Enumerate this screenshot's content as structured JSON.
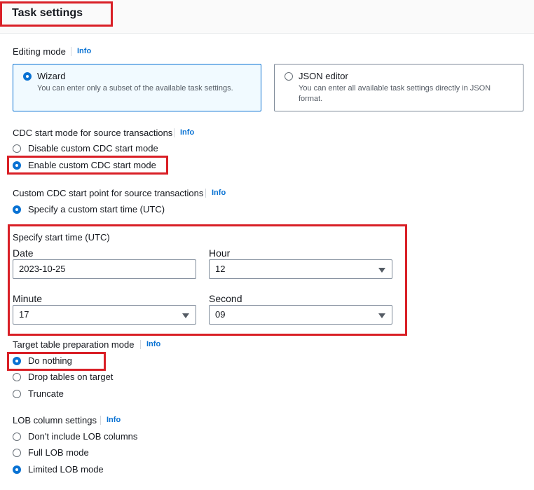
{
  "header": {
    "title": "Task settings"
  },
  "info_label": "Info",
  "editing_mode": {
    "label": "Editing mode",
    "options": [
      {
        "title": "Wizard",
        "description": "You can enter only a subset of the available task settings.",
        "selected": true
      },
      {
        "title": "JSON editor",
        "description": "You can enter all available task settings directly in JSON format.",
        "selected": false
      }
    ]
  },
  "cdc_start_mode": {
    "label": "CDC start mode for source transactions",
    "options": [
      {
        "label": "Disable custom CDC start mode",
        "selected": false
      },
      {
        "label": "Enable custom CDC start mode",
        "selected": true
      }
    ]
  },
  "cdc_start_point": {
    "label": "Custom CDC start point for source transactions",
    "options": [
      {
        "label": "Specify a custom start time (UTC)",
        "selected": true
      }
    ]
  },
  "start_time": {
    "label": "Specify start time (UTC)",
    "date": {
      "label": "Date",
      "value": "2023-10-25"
    },
    "hour": {
      "label": "Hour",
      "value": "12"
    },
    "minute": {
      "label": "Minute",
      "value": "17"
    },
    "second": {
      "label": "Second",
      "value": "09"
    }
  },
  "target_prep": {
    "label": "Target table preparation mode",
    "options": [
      {
        "label": "Do nothing",
        "selected": true
      },
      {
        "label": "Drop tables on target",
        "selected": false
      },
      {
        "label": "Truncate",
        "selected": false
      }
    ]
  },
  "lob": {
    "label": "LOB column settings",
    "options": [
      {
        "label": "Don't include LOB columns",
        "selected": false
      },
      {
        "label": "Full LOB mode",
        "selected": false
      },
      {
        "label": "Limited LOB mode",
        "selected": true
      }
    ]
  },
  "colors": {
    "accent": "#0972d3",
    "highlight": "#d91f26"
  }
}
